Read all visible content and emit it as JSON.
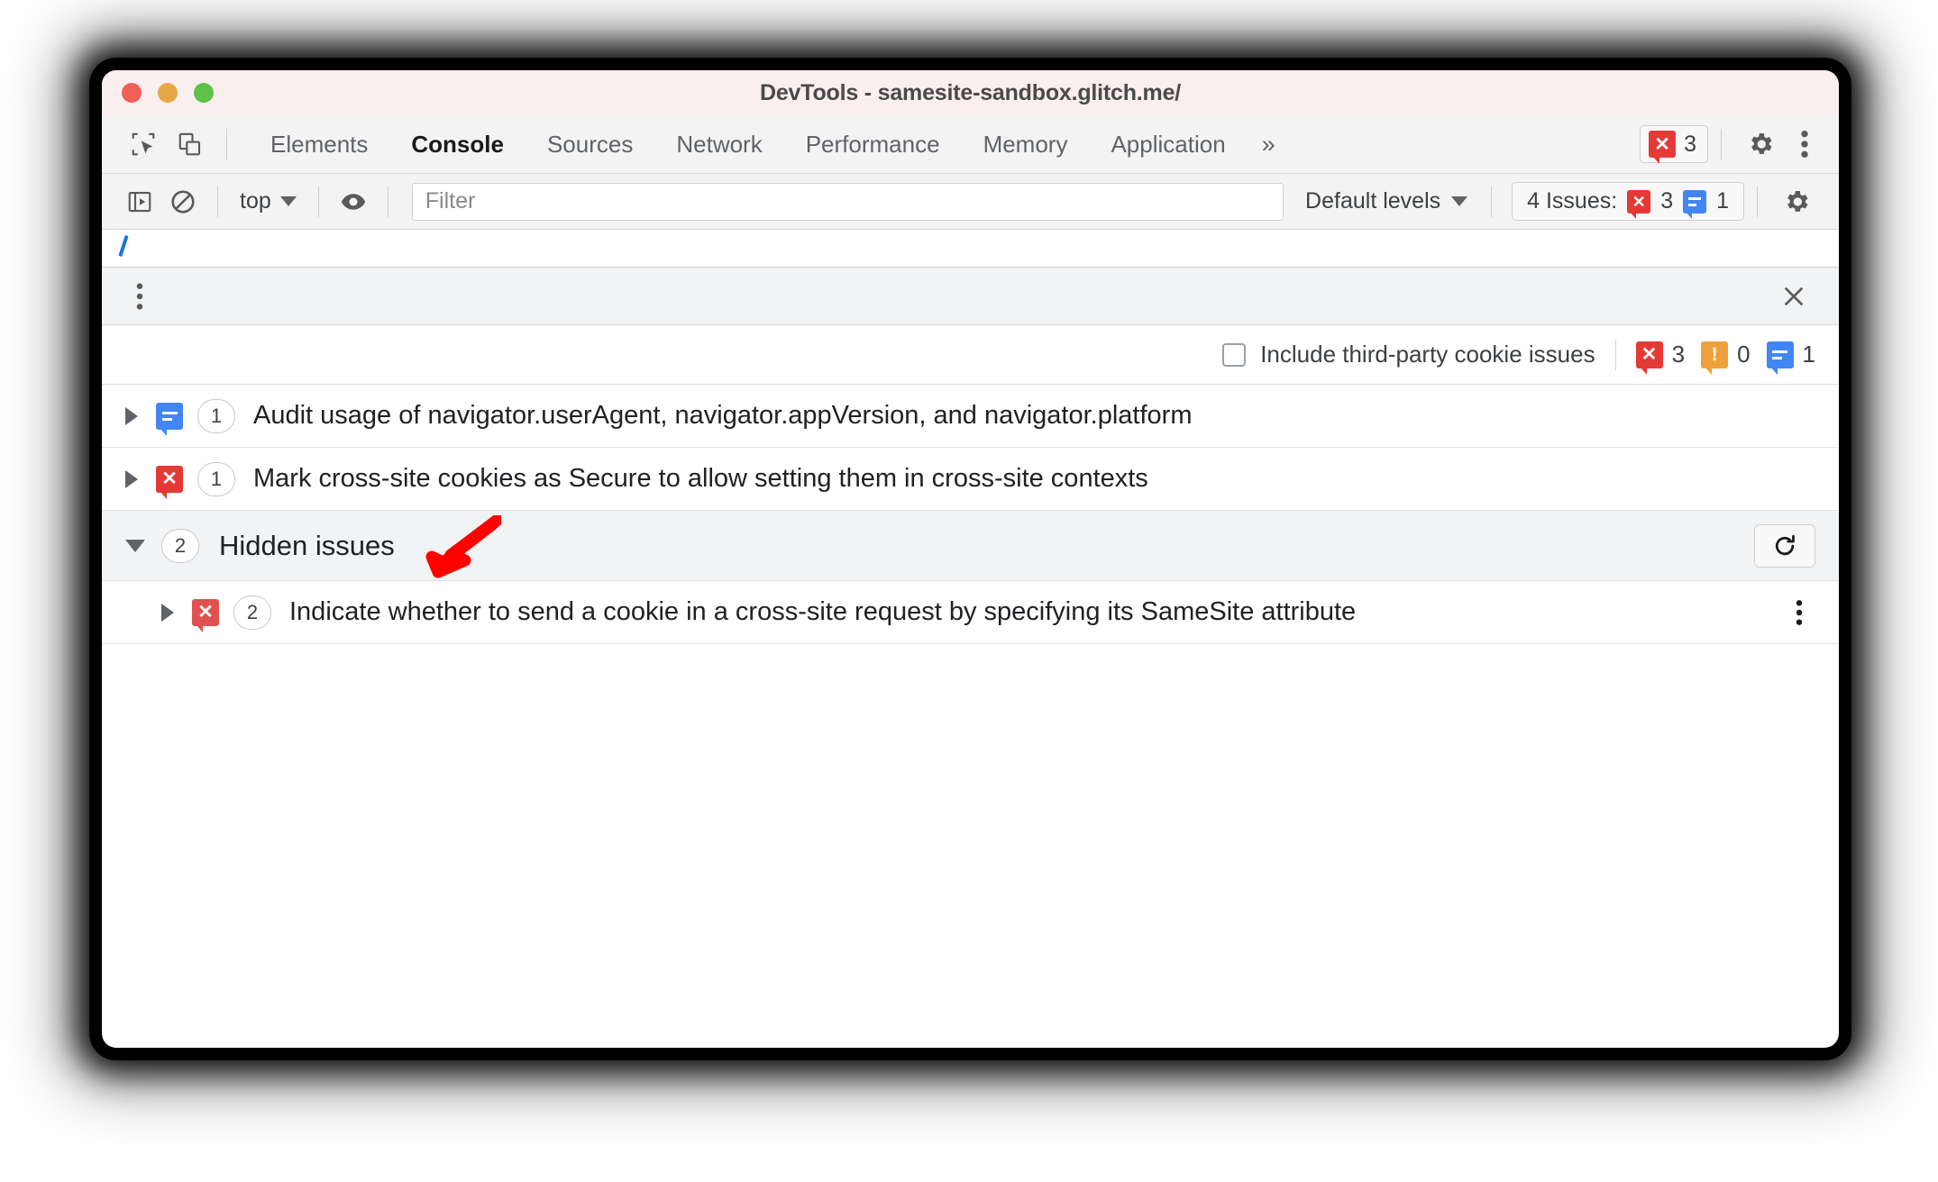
{
  "window": {
    "title": "DevTools - samesite-sandbox.glitch.me/",
    "traffic_lights": [
      "close",
      "minimize",
      "zoom"
    ],
    "colors": {
      "titlebar_bg": "#fbeeef",
      "toolbar_bg": "#f3f3f3",
      "drawer_bg": "#f1f3f4",
      "error_red": "#e53935",
      "warning_orange": "#f0a03a",
      "info_blue": "#4285f4",
      "annotation_red": "#ff0000"
    }
  },
  "tabbar": {
    "inspect_icon": "inspect-element-icon",
    "device_icon": "device-toolbar-icon",
    "tabs": [
      {
        "label": "Elements",
        "active": false
      },
      {
        "label": "Console",
        "active": true
      },
      {
        "label": "Sources",
        "active": false
      },
      {
        "label": "Network",
        "active": false
      },
      {
        "label": "Performance",
        "active": false
      },
      {
        "label": "Memory",
        "active": false
      },
      {
        "label": "Application",
        "active": false
      }
    ],
    "more_tabs_glyph": "»",
    "error_badge": {
      "icon": "error-icon",
      "count": "3"
    },
    "settings_icon": "gear-icon",
    "menu_icon": "kebab-menu-icon"
  },
  "console_toolbar": {
    "sidebar_toggle_icon": "console-sidebar-icon",
    "clear_console_icon": "clear-console-icon",
    "context_selector": {
      "value": "top",
      "caret": "chevron-down-icon"
    },
    "live_expression_icon": "eye-icon",
    "filter": {
      "placeholder": "Filter",
      "value": ""
    },
    "log_levels": {
      "value": "Default levels",
      "caret": "chevron-down-icon"
    },
    "issues_button": {
      "label": "4 Issues:",
      "error_count": "3",
      "info_count": "1"
    },
    "settings_icon": "gear-icon"
  },
  "drawer": {
    "kebab_icon": "kebab-menu-icon",
    "close_icon": "close-icon",
    "toolbar": {
      "cookie_checkbox_label": "Include third-party cookie issues",
      "cookie_checkbox_checked": false,
      "counts": [
        {
          "kind": "error",
          "value": "3"
        },
        {
          "kind": "warning",
          "value": "0"
        },
        {
          "kind": "info",
          "value": "1"
        }
      ]
    },
    "issues": [
      {
        "kind": "info",
        "count": "1",
        "title": "Audit usage of navigator.userAgent, navigator.appVersion, and navigator.platform",
        "expanded": false
      },
      {
        "kind": "error",
        "count": "1",
        "title": "Mark cross-site cookies as Secure to allow setting them in cross-site contexts",
        "expanded": false
      }
    ],
    "hidden_group": {
      "label": "Hidden issues",
      "count": "2",
      "expanded": true,
      "restore_button_icon": "restore-refresh-icon",
      "items": [
        {
          "kind": "error",
          "count": "2",
          "title": "Indicate whether to send a cookie in a cross-site request by specifying its SameSite attribute",
          "expanded": false,
          "menu_icon": "kebab-menu-icon"
        }
      ]
    }
  },
  "annotation": {
    "arrow_icon": "red-pointer-arrow",
    "points_at": "Hidden issues"
  }
}
